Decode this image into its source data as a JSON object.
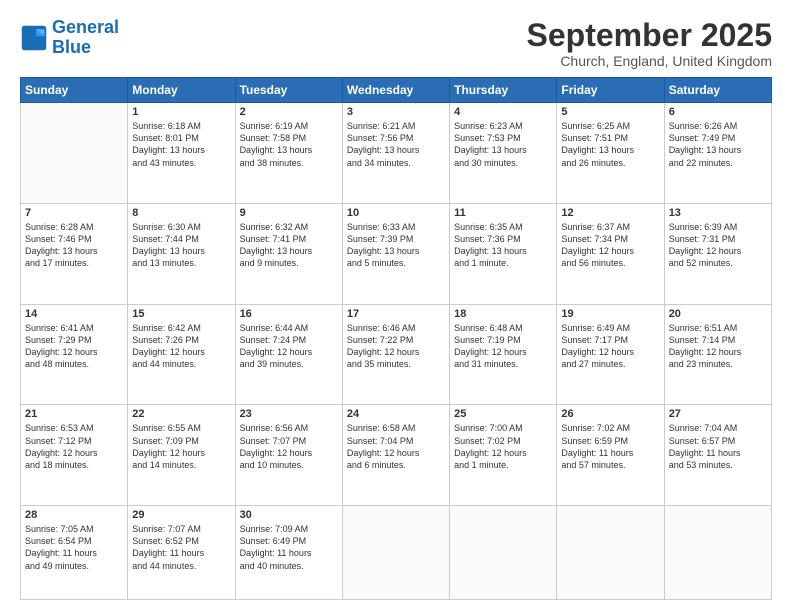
{
  "logo": {
    "line1": "General",
    "line2": "Blue"
  },
  "title": "September 2025",
  "location": "Church, England, United Kingdom",
  "weekdays": [
    "Sunday",
    "Monday",
    "Tuesday",
    "Wednesday",
    "Thursday",
    "Friday",
    "Saturday"
  ],
  "weeks": [
    [
      {
        "day": "",
        "info": ""
      },
      {
        "day": "1",
        "info": "Sunrise: 6:18 AM\nSunset: 8:01 PM\nDaylight: 13 hours\nand 43 minutes."
      },
      {
        "day": "2",
        "info": "Sunrise: 6:19 AM\nSunset: 7:58 PM\nDaylight: 13 hours\nand 38 minutes."
      },
      {
        "day": "3",
        "info": "Sunrise: 6:21 AM\nSunset: 7:56 PM\nDaylight: 13 hours\nand 34 minutes."
      },
      {
        "day": "4",
        "info": "Sunrise: 6:23 AM\nSunset: 7:53 PM\nDaylight: 13 hours\nand 30 minutes."
      },
      {
        "day": "5",
        "info": "Sunrise: 6:25 AM\nSunset: 7:51 PM\nDaylight: 13 hours\nand 26 minutes."
      },
      {
        "day": "6",
        "info": "Sunrise: 6:26 AM\nSunset: 7:49 PM\nDaylight: 13 hours\nand 22 minutes."
      }
    ],
    [
      {
        "day": "7",
        "info": "Sunrise: 6:28 AM\nSunset: 7:46 PM\nDaylight: 13 hours\nand 17 minutes."
      },
      {
        "day": "8",
        "info": "Sunrise: 6:30 AM\nSunset: 7:44 PM\nDaylight: 13 hours\nand 13 minutes."
      },
      {
        "day": "9",
        "info": "Sunrise: 6:32 AM\nSunset: 7:41 PM\nDaylight: 13 hours\nand 9 minutes."
      },
      {
        "day": "10",
        "info": "Sunrise: 6:33 AM\nSunset: 7:39 PM\nDaylight: 13 hours\nand 5 minutes."
      },
      {
        "day": "11",
        "info": "Sunrise: 6:35 AM\nSunset: 7:36 PM\nDaylight: 13 hours\nand 1 minute."
      },
      {
        "day": "12",
        "info": "Sunrise: 6:37 AM\nSunset: 7:34 PM\nDaylight: 12 hours\nand 56 minutes."
      },
      {
        "day": "13",
        "info": "Sunrise: 6:39 AM\nSunset: 7:31 PM\nDaylight: 12 hours\nand 52 minutes."
      }
    ],
    [
      {
        "day": "14",
        "info": "Sunrise: 6:41 AM\nSunset: 7:29 PM\nDaylight: 12 hours\nand 48 minutes."
      },
      {
        "day": "15",
        "info": "Sunrise: 6:42 AM\nSunset: 7:26 PM\nDaylight: 12 hours\nand 44 minutes."
      },
      {
        "day": "16",
        "info": "Sunrise: 6:44 AM\nSunset: 7:24 PM\nDaylight: 12 hours\nand 39 minutes."
      },
      {
        "day": "17",
        "info": "Sunrise: 6:46 AM\nSunset: 7:22 PM\nDaylight: 12 hours\nand 35 minutes."
      },
      {
        "day": "18",
        "info": "Sunrise: 6:48 AM\nSunset: 7:19 PM\nDaylight: 12 hours\nand 31 minutes."
      },
      {
        "day": "19",
        "info": "Sunrise: 6:49 AM\nSunset: 7:17 PM\nDaylight: 12 hours\nand 27 minutes."
      },
      {
        "day": "20",
        "info": "Sunrise: 6:51 AM\nSunset: 7:14 PM\nDaylight: 12 hours\nand 23 minutes."
      }
    ],
    [
      {
        "day": "21",
        "info": "Sunrise: 6:53 AM\nSunset: 7:12 PM\nDaylight: 12 hours\nand 18 minutes."
      },
      {
        "day": "22",
        "info": "Sunrise: 6:55 AM\nSunset: 7:09 PM\nDaylight: 12 hours\nand 14 minutes."
      },
      {
        "day": "23",
        "info": "Sunrise: 6:56 AM\nSunset: 7:07 PM\nDaylight: 12 hours\nand 10 minutes."
      },
      {
        "day": "24",
        "info": "Sunrise: 6:58 AM\nSunset: 7:04 PM\nDaylight: 12 hours\nand 6 minutes."
      },
      {
        "day": "25",
        "info": "Sunrise: 7:00 AM\nSunset: 7:02 PM\nDaylight: 12 hours\nand 1 minute."
      },
      {
        "day": "26",
        "info": "Sunrise: 7:02 AM\nSunset: 6:59 PM\nDaylight: 11 hours\nand 57 minutes."
      },
      {
        "day": "27",
        "info": "Sunrise: 7:04 AM\nSunset: 6:57 PM\nDaylight: 11 hours\nand 53 minutes."
      }
    ],
    [
      {
        "day": "28",
        "info": "Sunrise: 7:05 AM\nSunset: 6:54 PM\nDaylight: 11 hours\nand 49 minutes."
      },
      {
        "day": "29",
        "info": "Sunrise: 7:07 AM\nSunset: 6:52 PM\nDaylight: 11 hours\nand 44 minutes."
      },
      {
        "day": "30",
        "info": "Sunrise: 7:09 AM\nSunset: 6:49 PM\nDaylight: 11 hours\nand 40 minutes."
      },
      {
        "day": "",
        "info": ""
      },
      {
        "day": "",
        "info": ""
      },
      {
        "day": "",
        "info": ""
      },
      {
        "day": "",
        "info": ""
      }
    ]
  ]
}
